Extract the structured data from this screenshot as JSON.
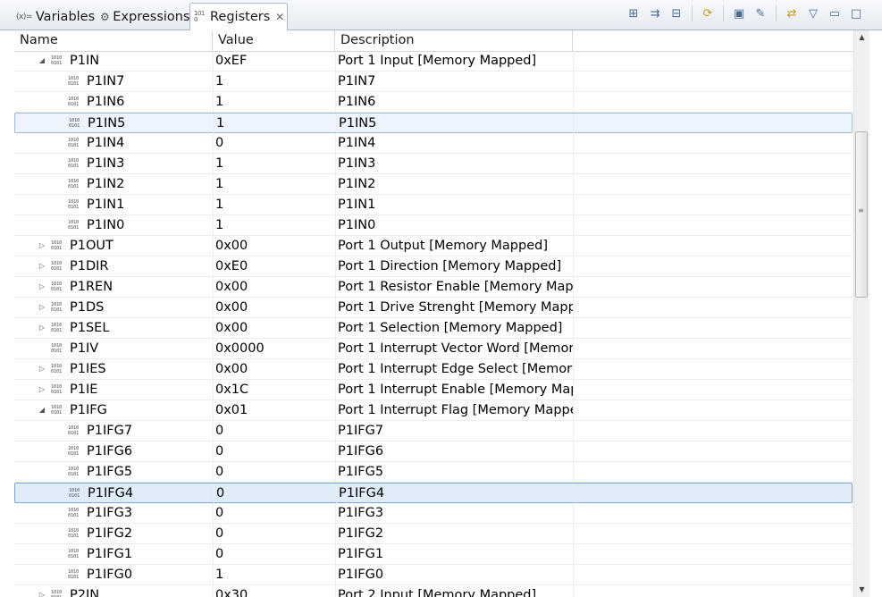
{
  "tabs": [
    {
      "icon": "(x)=",
      "label": "Variables"
    },
    {
      "icon": "⚙",
      "label": "Expressions"
    },
    {
      "icon": "1010",
      "label": "Registers"
    }
  ],
  "columns": [
    "Name",
    "Value",
    "Description"
  ],
  "rows": [
    {
      "indent": 1,
      "expander": "expanded",
      "name": "P1IN",
      "value": "0xEF",
      "desc": "Port 1 Input [Memory Mapped]"
    },
    {
      "indent": 2,
      "expander": "none",
      "name": "P1IN7",
      "value": "1",
      "desc": "P1IN7"
    },
    {
      "indent": 2,
      "expander": "none",
      "name": "P1IN6",
      "value": "1",
      "desc": "P1IN6"
    },
    {
      "indent": 2,
      "expander": "none",
      "name": "P1IN5",
      "value": "1",
      "desc": "P1IN5",
      "state": "hover"
    },
    {
      "indent": 2,
      "expander": "none",
      "name": "P1IN4",
      "value": "0",
      "desc": "P1IN4"
    },
    {
      "indent": 2,
      "expander": "none",
      "name": "P1IN3",
      "value": "1",
      "desc": "P1IN3"
    },
    {
      "indent": 2,
      "expander": "none",
      "name": "P1IN2",
      "value": "1",
      "desc": "P1IN2"
    },
    {
      "indent": 2,
      "expander": "none",
      "name": "P1IN1",
      "value": "1",
      "desc": "P1IN1"
    },
    {
      "indent": 2,
      "expander": "none",
      "name": "P1IN0",
      "value": "1",
      "desc": "P1IN0"
    },
    {
      "indent": 1,
      "expander": "collapsed",
      "name": "P1OUT",
      "value": "0x00",
      "desc": "Port 1 Output [Memory Mapped]"
    },
    {
      "indent": 1,
      "expander": "collapsed",
      "name": "P1DIR",
      "value": "0xE0",
      "desc": "Port 1 Direction [Memory Mapped]"
    },
    {
      "indent": 1,
      "expander": "collapsed",
      "name": "P1REN",
      "value": "0x00",
      "desc": "Port 1 Resistor Enable [Memory Mapp..."
    },
    {
      "indent": 1,
      "expander": "collapsed",
      "name": "P1DS",
      "value": "0x00",
      "desc": "Port 1 Drive Strenght [Memory Mapp..."
    },
    {
      "indent": 1,
      "expander": "collapsed",
      "name": "P1SEL",
      "value": "0x00",
      "desc": "Port 1 Selection [Memory Mapped]"
    },
    {
      "indent": 1,
      "expander": "none",
      "name": "P1IV",
      "value": "0x0000",
      "desc": "Port 1 Interrupt Vector Word [Memory..."
    },
    {
      "indent": 1,
      "expander": "collapsed",
      "name": "P1IES",
      "value": "0x00",
      "desc": "Port 1 Interrupt Edge Select [Memory ..."
    },
    {
      "indent": 1,
      "expander": "collapsed",
      "name": "P1IE",
      "value": "0x1C",
      "desc": "Port 1 Interrupt Enable [Memory Map..."
    },
    {
      "indent": 1,
      "expander": "expanded",
      "name": "P1IFG",
      "value": "0x01",
      "desc": "Port 1 Interrupt Flag [Memory Mapped]"
    },
    {
      "indent": 2,
      "expander": "none",
      "name": "P1IFG7",
      "value": "0",
      "desc": "P1IFG7"
    },
    {
      "indent": 2,
      "expander": "none",
      "name": "P1IFG6",
      "value": "0",
      "desc": "P1IFG6"
    },
    {
      "indent": 2,
      "expander": "none",
      "name": "P1IFG5",
      "value": "0",
      "desc": "P1IFG5"
    },
    {
      "indent": 2,
      "expander": "none",
      "name": "P1IFG4",
      "value": "0",
      "desc": "P1IFG4",
      "state": "selected"
    },
    {
      "indent": 2,
      "expander": "none",
      "name": "P1IFG3",
      "value": "0",
      "desc": "P1IFG3"
    },
    {
      "indent": 2,
      "expander": "none",
      "name": "P1IFG2",
      "value": "0",
      "desc": "P1IFG2"
    },
    {
      "indent": 2,
      "expander": "none",
      "name": "P1IFG1",
      "value": "0",
      "desc": "P1IFG1"
    },
    {
      "indent": 2,
      "expander": "none",
      "name": "P1IFG0",
      "value": "1",
      "desc": "P1IFG0"
    },
    {
      "indent": 1,
      "expander": "collapsed",
      "name": "P2IN",
      "value": "0x30",
      "desc": "Port 2 Input [Memory Mapped]"
    }
  ]
}
